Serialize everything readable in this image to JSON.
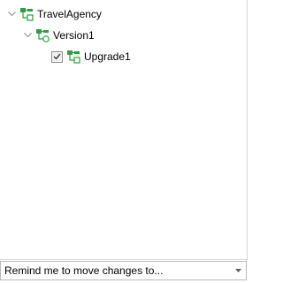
{
  "tree": {
    "nodes": [
      {
        "label": "TravelAgency",
        "icon": "kb-tree-icon",
        "expanded": true
      },
      {
        "label": "Version1",
        "icon": "version-tree-icon",
        "expanded": true
      },
      {
        "label": "Upgrade1",
        "icon": "upgrade-tree-icon",
        "checked": true
      }
    ]
  },
  "footer": {
    "combo_value": "Remind me to move changes to..."
  },
  "colors": {
    "icon_green": "#2f9e44",
    "icon_dark_green": "#1e7b34",
    "expander_gray": "#8a8a8a",
    "check_mark": "#3a3a3a"
  }
}
